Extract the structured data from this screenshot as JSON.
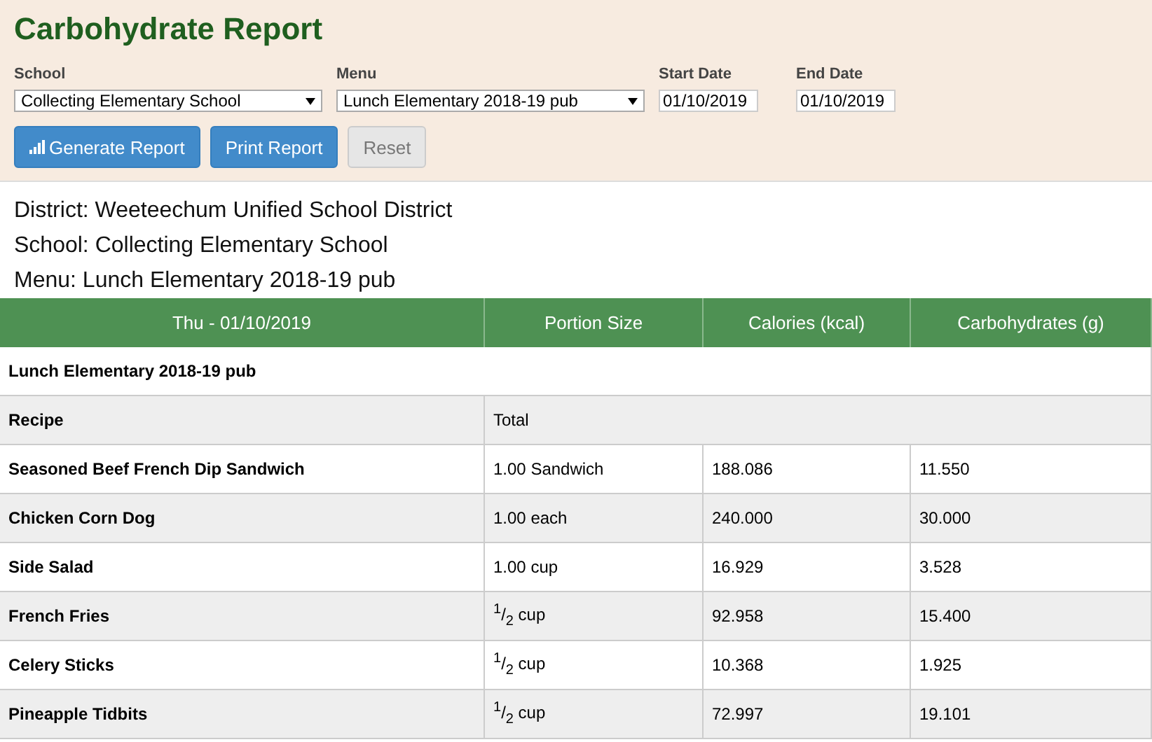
{
  "title": "Carbohydrate Report",
  "filters": [
    {
      "kind": "select",
      "label": "School",
      "value": "Collecting Elementary School"
    },
    {
      "kind": "select",
      "label": "Menu",
      "value": "Lunch Elementary 2018-19 pub"
    },
    {
      "kind": "date",
      "label": "Start Date",
      "value": "01/10/2019"
    },
    {
      "kind": "date",
      "label": "End Date",
      "value": "01/10/2019"
    }
  ],
  "buttons": [
    {
      "label": "Generate Report",
      "kind": "primary",
      "icon": true
    },
    {
      "label": "Print Report",
      "kind": "primary",
      "icon": false
    },
    {
      "label": "Reset",
      "kind": "default",
      "icon": false
    }
  ],
  "info": [
    "District: Weeteechum Unified School District",
    "School: Collecting Elementary School",
    "Menu: Lunch Elementary 2018-19 pub"
  ],
  "table": {
    "columns": [
      "Thu - 01/10/2019",
      "Portion Size",
      "Calories (kcal)",
      "Carbohydrates (g)"
    ],
    "section": "Lunch Elementary 2018-19 pub",
    "subheader": [
      "Recipe",
      "Total"
    ],
    "rows": [
      {
        "recipe": "Seasoned Beef French Dip Sandwich",
        "portion": "1.00 Sandwich",
        "calories": "188.086",
        "carbs": "11.550"
      },
      {
        "recipe": "Chicken Corn Dog",
        "portion": "1.00 each",
        "calories": "240.000",
        "carbs": "30.000"
      },
      {
        "recipe": "Side Salad",
        "portion": "1.00 cup",
        "calories": "16.929",
        "carbs": "3.528"
      },
      {
        "recipe": "French Fries",
        "portion": "$^{1}$/$_{2}$ cup",
        "calories": "92.958",
        "carbs": "15.400"
      },
      {
        "recipe": "Celery Sticks",
        "portion": "$^{1}$/$_{2}$ cup",
        "calories": "10.368",
        "carbs": "1.925"
      },
      {
        "recipe": "Pineapple Tidbits",
        "portion": "$^{1}$/$_{2}$ cup",
        "calories": "72.997",
        "carbs": "19.101"
      }
    ]
  }
}
